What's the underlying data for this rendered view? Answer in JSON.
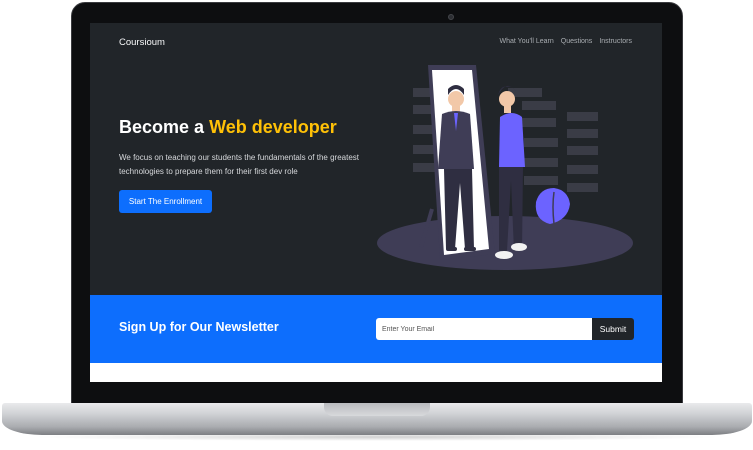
{
  "navbar": {
    "brand": "Coursioum",
    "links": [
      "What You'll Learn",
      "Questions",
      "Instructors"
    ]
  },
  "hero": {
    "title_prefix": "Become a",
    "title_accent": "Web developer",
    "description": "We focus on teaching our students the fundamentals of the greatest technologies to prepare them for their first dev role",
    "cta_label": "Start The Enrollment",
    "illustration_icon": "man-looking-in-mirror-illustration"
  },
  "newsletter": {
    "title": "Sign Up for Our Newsletter",
    "email_placeholder": "Enter Your Email",
    "email_value": "",
    "submit_label": "Submit"
  },
  "colors": {
    "background": "#212529",
    "accent": "#ffc107",
    "primary": "#0d6efd",
    "illustration_purple": "#6c63ff"
  }
}
